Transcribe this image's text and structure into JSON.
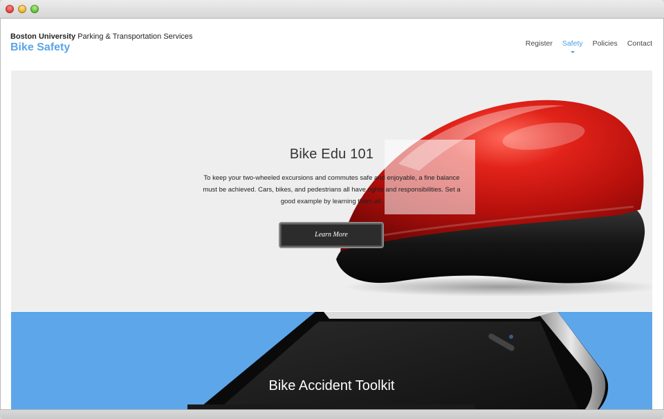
{
  "header": {
    "brand_bold": "Boston University",
    "brand_rest": "Parking & Transportation Services",
    "site_title": "Bike Safety"
  },
  "nav": {
    "items": [
      "Register",
      "Safety",
      "Policies",
      "Contact"
    ],
    "active": "Safety"
  },
  "hero": {
    "title": "Bike Edu 101",
    "text": "To keep your two-wheeled excursions and commutes safe and enjoyable, a fine balance must be achieved. Cars, bikes, and pedestrians all have rights and responsibilities. Set a good example by learning them all.",
    "button_label": "Learn More"
  },
  "section2": {
    "title": "Bike Accident Toolkit"
  },
  "colors": {
    "accent": "#5aa5e8",
    "hero_bg": "#eeeeee",
    "section2_bg": "#5ea6ea",
    "button_bg": "#2c2c2c"
  }
}
